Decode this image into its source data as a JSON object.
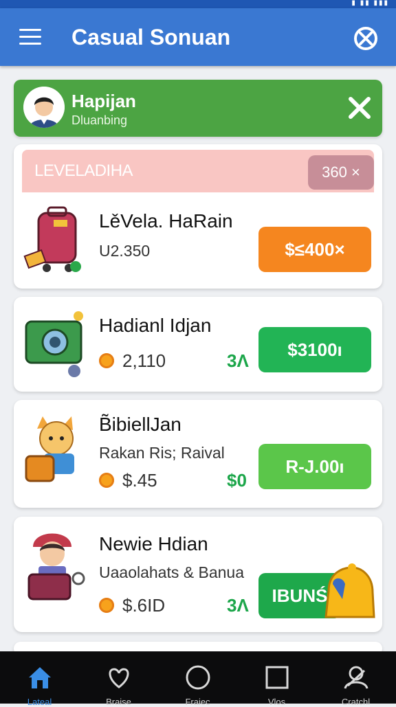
{
  "app": {
    "title": "Casual Sonuan"
  },
  "user": {
    "name": "Hapijan",
    "subtitle": "Dluanbing"
  },
  "level": {
    "label": "LEVELADIHA",
    "badge": "360 ×"
  },
  "items": [
    {
      "title": "LěVela. HaRain",
      "subtitle": "U2.350",
      "action": "$≤400×",
      "action_color": "#f5861f",
      "icon": "luggage-icon"
    },
    {
      "title": "Hadianl Idjan",
      "price": "2,110",
      "value": "3Λ",
      "action": "$3100ı",
      "action_color": "#22b455",
      "icon": "camera-bag-icon"
    },
    {
      "title": "B̃ibiellJan",
      "subtitle": "Rakan Ris; Raival",
      "price": "$.45",
      "value": "$0",
      "action": "R-J.00ı",
      "action_color": "#5bc64a",
      "icon": "cat-backpack-icon"
    },
    {
      "title": "Newie Hdian",
      "subtitle": "Uaaolahats & Banua",
      "price": "$.6ID",
      "value": "3Λ",
      "action": "IBUNŚ",
      "action_color": "#1ea84b",
      "icon": "traveler-icon"
    }
  ],
  "nav": [
    {
      "label": "Lateal",
      "icon": "home-icon",
      "active": true
    },
    {
      "label": "Braise",
      "icon": "heart-icon",
      "active": false
    },
    {
      "label": "Fraiec",
      "icon": "circle-icon",
      "active": false
    },
    {
      "label": "Vlos",
      "icon": "square-icon",
      "active": false
    },
    {
      "label": "Cratchl",
      "icon": "profile-icon",
      "active": false
    }
  ],
  "colors": {
    "appbar": "#3a78d2",
    "userbar": "#4ca443",
    "nav": "#0c0c0d"
  }
}
